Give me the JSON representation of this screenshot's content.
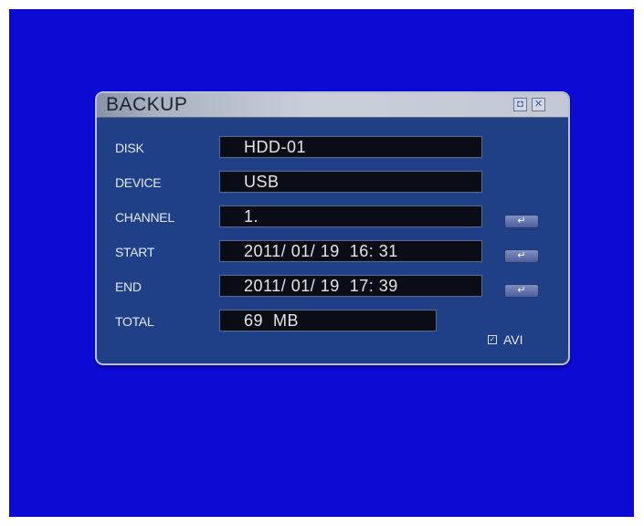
{
  "dialog": {
    "title": "BACKUP",
    "title_buttons": [
      {
        "icon": "setup-icon",
        "glyph": "◘"
      },
      {
        "icon": "close-icon",
        "glyph": "✕"
      }
    ]
  },
  "rows": [
    {
      "label": "DISK",
      "value": "HDD-01",
      "has_enter": false
    },
    {
      "label": "DEVICE",
      "value": "USB",
      "has_enter": false
    },
    {
      "label": "CHANNEL",
      "value": "1.",
      "has_enter": true
    },
    {
      "label": "START",
      "value": "2011/ 01/ 19  16: 31",
      "has_enter": true
    },
    {
      "label": "END",
      "value": "2011/ 01/ 19  17: 39",
      "has_enter": true
    },
    {
      "label": "TOTAL",
      "value": "69  MB",
      "has_enter": false
    }
  ],
  "enter_icon": "↵",
  "avi": {
    "label": "AVI",
    "checked": true,
    "check_glyph": "✓"
  },
  "colors": {
    "background": "#0d0ad6",
    "dialog": "#1f3f86",
    "field": "#0b0d16",
    "titlebar": "#c9cfd9"
  }
}
